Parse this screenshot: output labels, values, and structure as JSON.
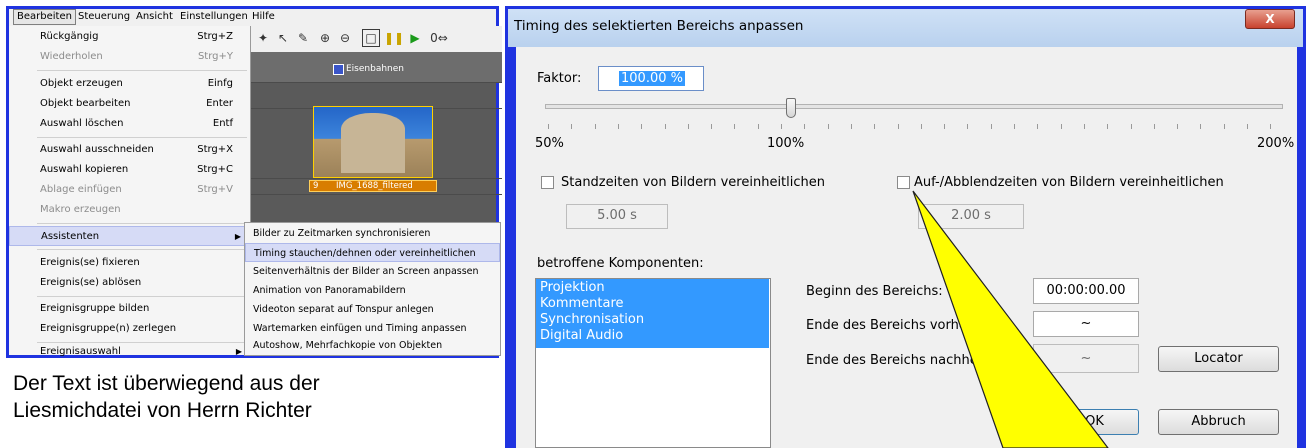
{
  "menu": {
    "bar": [
      "Bearbeiten",
      "Steuerung",
      "Ansicht",
      "Einstellungen",
      "Hilfe"
    ],
    "items": [
      {
        "label": "Rückgängig",
        "shortcut": "Strg+Z"
      },
      {
        "label": "Wiederholen",
        "shortcut": "Strg+Y"
      },
      {
        "label": "Objekt erzeugen",
        "shortcut": "Einfg"
      },
      {
        "label": "Objekt bearbeiten",
        "shortcut": "Enter"
      },
      {
        "label": "Auswahl löschen",
        "shortcut": "Entf"
      },
      {
        "label": "Auswahl ausschneiden",
        "shortcut": "Strg+X"
      },
      {
        "label": "Auswahl kopieren",
        "shortcut": "Strg+C"
      },
      {
        "label": "Ablage einfügen",
        "shortcut": "Strg+V"
      },
      {
        "label": "Makro erzeugen",
        "shortcut": ""
      },
      {
        "label": "Assistenten",
        "shortcut": ""
      },
      {
        "label": "Ereignis(se) fixieren",
        "shortcut": ""
      },
      {
        "label": "Ereignis(se) ablösen",
        "shortcut": ""
      },
      {
        "label": "Ereignisgruppe bilden",
        "shortcut": ""
      },
      {
        "label": "Ereignisgruppe(n) zerlegen",
        "shortcut": ""
      },
      {
        "label": "Ereignisauswahl",
        "shortcut": ""
      }
    ],
    "submenu": [
      "Bilder zu Zeitmarken synchronisieren",
      "Timing stauchen/dehnen oder vereinheitlichen",
      "Seitenverhältnis der Bilder an Screen anpassen",
      "Animation von Panoramabildern",
      "Videoton separat auf Tonspur anlegen",
      "Wartemarken einfügen und Timing anpassen",
      "Autoshow, Mehrfachkopie von Objekten"
    ],
    "timeline_label": "Eisenbahnen",
    "clip_label": "IMG_1688_filtered",
    "clip_number": "9"
  },
  "body_text": {
    "line1": "Der Text ist überwiegend aus der",
    "line2": "Liesmichdatei von Herrn Richter"
  },
  "dialog": {
    "title": "Timing des selektierten Bereichs anpassen",
    "close": "X",
    "factor_label": "Faktor:",
    "factor_value": "100.00 %",
    "scale_min": "50%",
    "scale_mid": "100%",
    "scale_max": "200%",
    "check_stand": "Standzeiten von Bildern vereinheitlichen",
    "check_fade": "Auf-/Abblendzeiten von Bildern vereinheitlichen",
    "stand_value": "5.00 s",
    "fade_value": "2.00 s",
    "components_label": "betroffene Komponenten:",
    "components": [
      "Projektion",
      "Kommentare",
      "Synchronisation",
      "Digital Audio"
    ],
    "begin_label": "Beginn des Bereichs:",
    "begin_value": "00:00:00.00",
    "end_before_label": "Ende des Bereichs vorher:",
    "end_before_value": "~",
    "end_after_label": "Ende des Bereichs nachher:",
    "end_after_value": "~",
    "locator": "Locator",
    "ok": "OK",
    "cancel": "Abbruch"
  },
  "colors": {
    "frame_blue": "#1f33e0",
    "selection_blue": "#3399ff",
    "callout_yellow": "#ffff00"
  }
}
